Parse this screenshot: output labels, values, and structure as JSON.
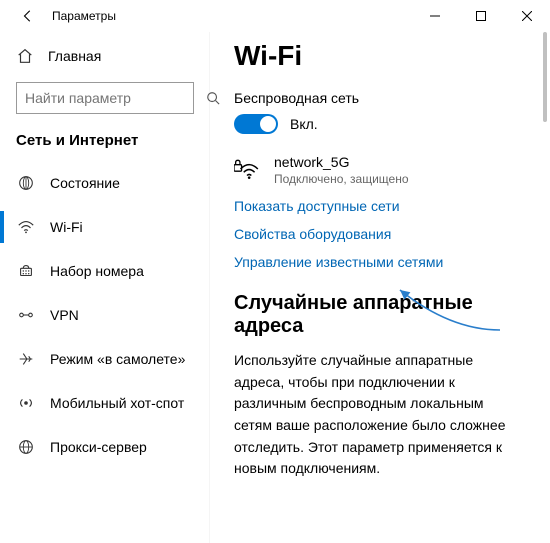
{
  "window": {
    "title": "Параметры"
  },
  "sidebar": {
    "home_label": "Главная",
    "search_placeholder": "Найти параметр",
    "category_title": "Сеть и Интернет",
    "items": [
      {
        "label": "Состояние"
      },
      {
        "label": "Wi-Fi"
      },
      {
        "label": "Набор номера"
      },
      {
        "label": "VPN"
      },
      {
        "label": "Режим «в самолете»"
      },
      {
        "label": "Мобильный хот-спот"
      },
      {
        "label": "Прокси-сервер"
      }
    ]
  },
  "main": {
    "page_title": "Wi-Fi",
    "wireless_heading": "Беспроводная сеть",
    "toggle_state_label": "Вкл.",
    "network": {
      "name": "network_5G",
      "status": "Подключено, защищено"
    },
    "links": {
      "show_networks": "Показать доступные сети",
      "hw_props": "Свойства оборудования",
      "manage_known": "Управление известными сетями"
    },
    "random_heading": "Случайные аппаратные адреса",
    "random_desc": "Используйте случайные аппаратные адреса, чтобы при подключении к различным беспроводным локальным сетям ваше расположение было сложнее отследить. Этот параметр применяется к новым подключениям."
  }
}
